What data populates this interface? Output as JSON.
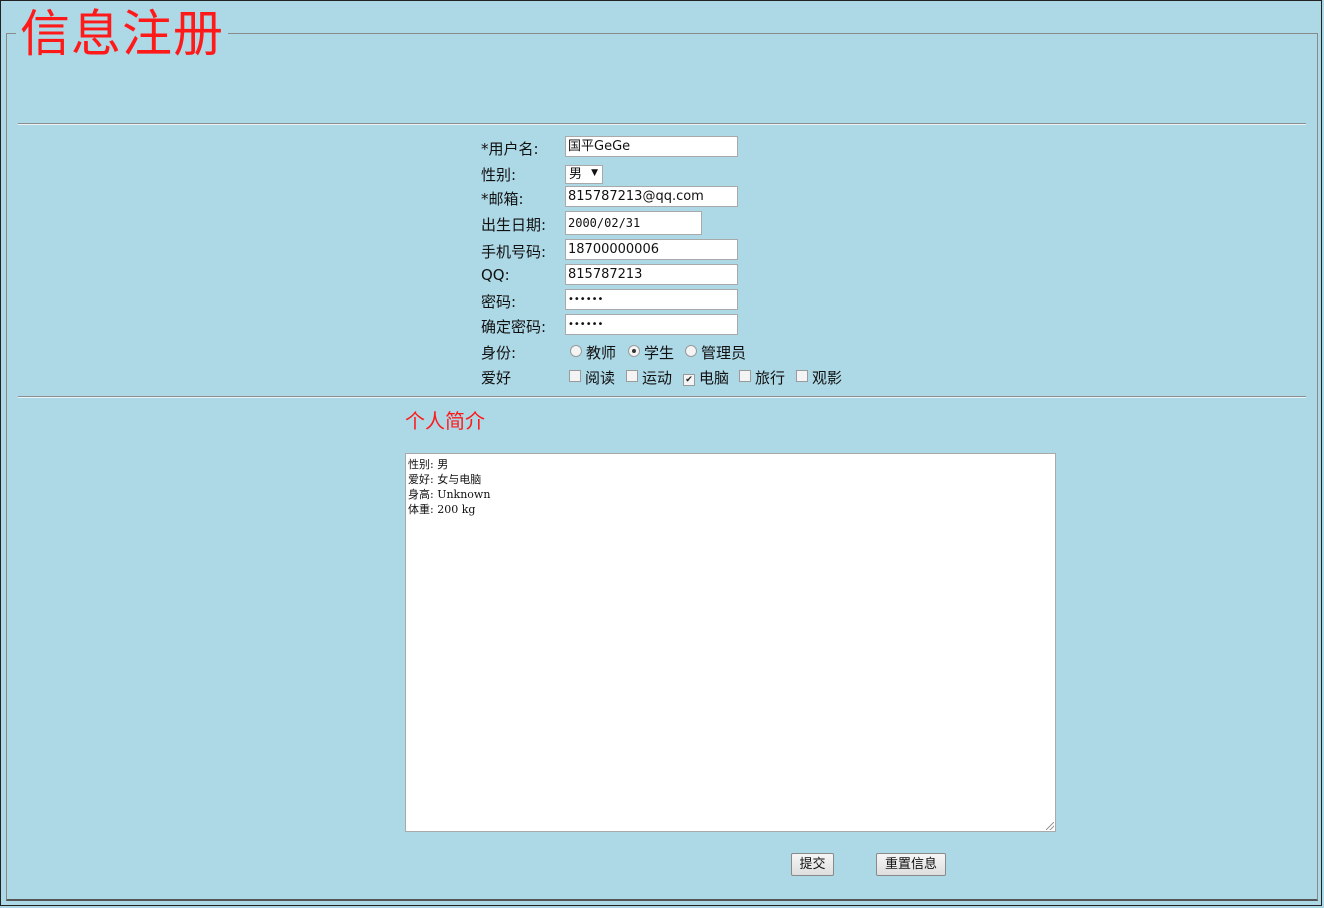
{
  "form": {
    "legend": "信息注册"
  },
  "fields": {
    "username": {
      "label": "*用户名:",
      "value": "国平GeGe"
    },
    "gender": {
      "label": "性别:",
      "value": "男"
    },
    "email": {
      "label": "*邮箱:",
      "value": "815787213@qq.com"
    },
    "birthday": {
      "label": "出生日期:",
      "value": "2000/02/31"
    },
    "phone": {
      "label": "手机号码:",
      "value": "18700000006"
    },
    "qq": {
      "label": "QQ:",
      "value": "815787213"
    },
    "password": {
      "label": "密码:",
      "value": "••••••"
    },
    "confirm_password": {
      "label": "确定密码:",
      "value": "••••••"
    },
    "identity": {
      "label": "身份:",
      "options": [
        {
          "label": "教师",
          "selected": false
        },
        {
          "label": "学生",
          "selected": true
        },
        {
          "label": "管理员",
          "selected": false
        }
      ]
    },
    "hobbies": {
      "label": "爱好",
      "options": [
        {
          "label": "阅读",
          "checked": false
        },
        {
          "label": "运动",
          "checked": false
        },
        {
          "label": "电脑",
          "checked": true
        },
        {
          "label": "旅行",
          "checked": false
        },
        {
          "label": "观影",
          "checked": false
        }
      ]
    }
  },
  "intro": {
    "title": "个人简介",
    "lines": [
      "性别: 男",
      "爱好: 女与电脑",
      "身高: Unknown",
      "体重: 200 kg"
    ]
  },
  "buttons": {
    "submit": "提交",
    "reset": "重置信息"
  },
  "icons": {
    "select_arrow": "triangle-down",
    "checkmark": "check"
  }
}
